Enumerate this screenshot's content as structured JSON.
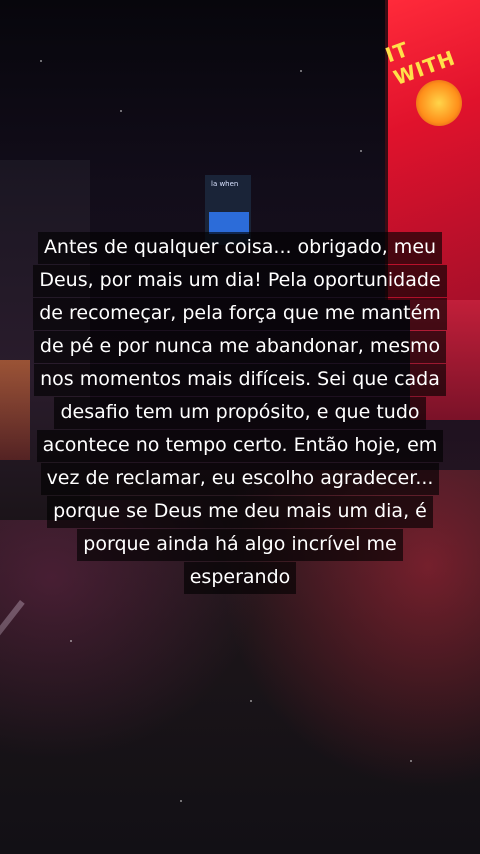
{
  "scene": {
    "description_colors": {
      "neon_red": "#e0122c",
      "neon_yellow": "#ffe14a",
      "sign_blue": "#2c6cd9"
    },
    "tower_sign_text": "la when",
    "billboard_text": "IT WITH"
  },
  "caption": {
    "lines": [
      "Antes de qualquer coisa... obrigado, meu",
      "Deus, por mais um dia! Pela oportunidade",
      "de recomeçar, pela força que me mantém",
      "de pé e por nunca me abandonar, mesmo",
      "nos momentos mais difíceis. Sei que cada",
      "desafio tem um propósito, e que tudo",
      "acontece no tempo certo. Então hoje, em",
      "vez de reclamar, eu escolho agradecer...",
      "porque se Deus me deu mais um dia, é",
      "porque ainda há algo incrível me",
      "esperando"
    ]
  }
}
